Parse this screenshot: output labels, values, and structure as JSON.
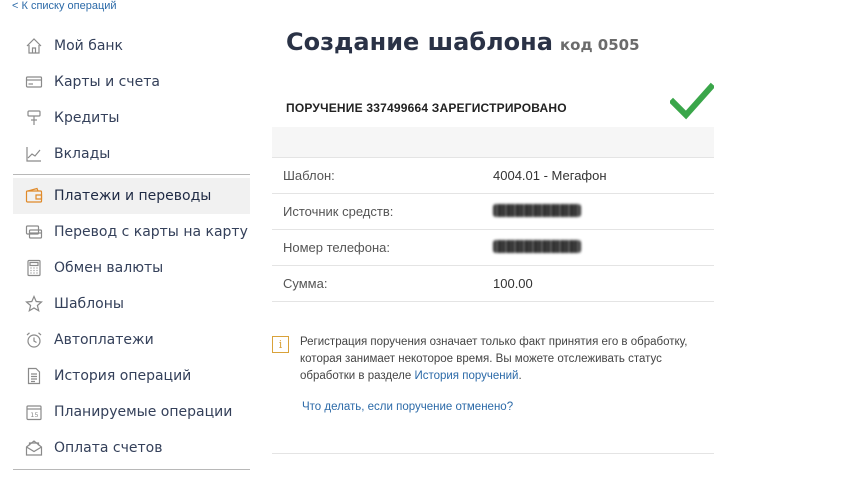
{
  "back_link": "< К списку операций",
  "sidebar": {
    "items": [
      {
        "label": "Мой банк",
        "icon": "home-icon"
      },
      {
        "label": "Карты и счета",
        "icon": "card-icon"
      },
      {
        "label": "Кредиты",
        "icon": "credit-icon"
      },
      {
        "label": "Вклады",
        "icon": "chart-icon"
      },
      {
        "label": "Платежи и переводы",
        "icon": "wallet-icon",
        "active": true
      },
      {
        "label": "Перевод с карты на карту",
        "icon": "card-transfer-icon"
      },
      {
        "label": "Обмен валюты",
        "icon": "calculator-icon"
      },
      {
        "label": "Шаблоны",
        "icon": "star-icon"
      },
      {
        "label": "Автоплатежи",
        "icon": "alarm-clock-icon"
      },
      {
        "label": "История операций",
        "icon": "document-icon"
      },
      {
        "label": "Планируемые операции",
        "icon": "calendar-icon"
      },
      {
        "label": "Оплата счетов",
        "icon": "envelope-icon"
      }
    ]
  },
  "main": {
    "title": "Создание шаблона",
    "code": "код 0505",
    "status": "ПОРУЧЕНИЕ 337499664 ЗАРЕГИСТРИРОВАНО",
    "details": [
      {
        "label": "Шаблон:",
        "value": "4004.01 - Мегафон",
        "redacted": false
      },
      {
        "label": "Источник средств:",
        "value": "",
        "redacted": true
      },
      {
        "label": "Номер телефона:",
        "value": "",
        "redacted": true
      },
      {
        "label": "Сумма:",
        "value": "100.00",
        "redacted": false
      }
    ],
    "notice_text": "Регистрация поручения означает только факт принятия его в обработку, которая занимает некоторое время. Вы можете отслеживать статус обработки в разделе ",
    "notice_link": "История поручений",
    "notice_end": ".",
    "cancel_link": "Что делать, если поручение отменено?"
  },
  "colors": {
    "accent_link": "#2c6aa8",
    "success_check": "#3aa64a",
    "info_icon": "#d9a23a"
  }
}
